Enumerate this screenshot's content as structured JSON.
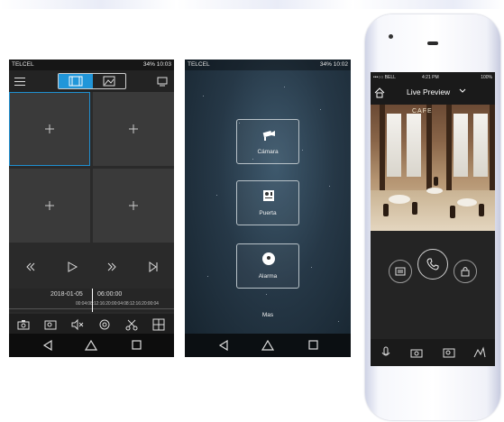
{
  "screen1": {
    "status": {
      "carrier": "TELCEL",
      "battery": "34%",
      "time": "10:03"
    },
    "timeline": {
      "date": "2018-01-05",
      "time": "06:00:00",
      "ticks": "00:04:08:12:16:20:00:04:08:12:16:20:00:04"
    }
  },
  "screen2": {
    "status": {
      "carrier": "TELCEL",
      "battery": "34%",
      "time": "10:02"
    },
    "menu": [
      {
        "label": "Cámara",
        "icon": "camera-icon"
      },
      {
        "label": "Puerta",
        "icon": "door-station-icon"
      },
      {
        "label": "Alarma",
        "icon": "alarm-icon"
      }
    ],
    "more_label": "Mas"
  },
  "screen3": {
    "status": {
      "carrier": "•••○○ BELL",
      "time": "4:21 PM",
      "battery": "100%"
    },
    "title": "Live Preview",
    "video_signage": [
      "CAFE"
    ]
  },
  "colors": {
    "accent": "#2196d9",
    "dark_bg": "#2a2a2a"
  }
}
